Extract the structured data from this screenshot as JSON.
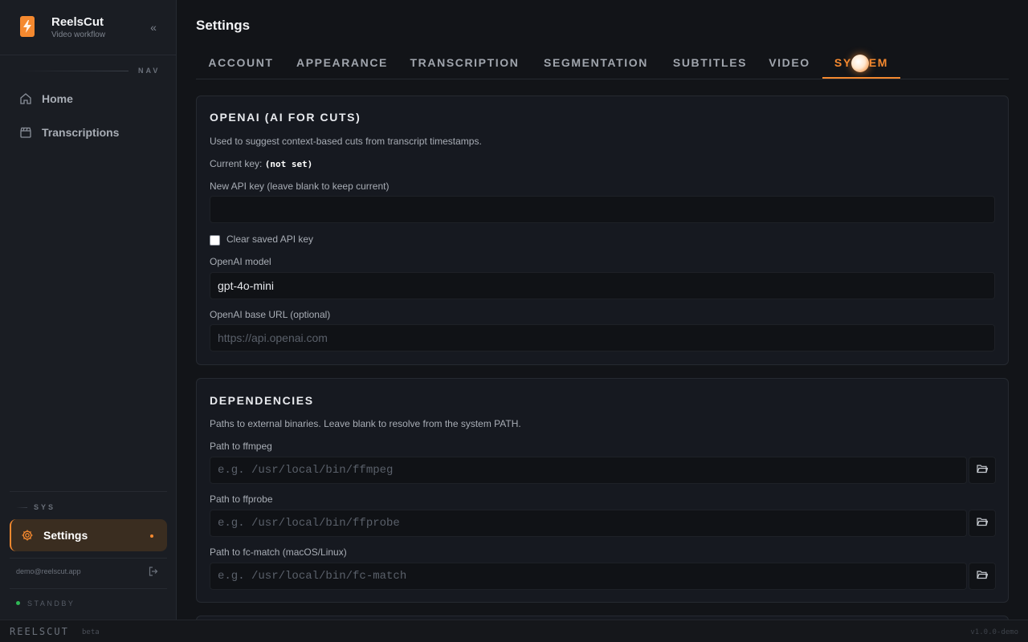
{
  "app": {
    "name": "ReelsCut",
    "subtitle": "Video workflow"
  },
  "sidebar": {
    "nav_section": "NAV",
    "nav_items": [
      {
        "label": "Home",
        "icon": "home-icon"
      },
      {
        "label": "Transcriptions",
        "icon": "clapperboard-icon"
      }
    ],
    "sys_section": "SYS",
    "sys_items": [
      {
        "label": "Settings",
        "icon": "gear-icon",
        "active": true
      }
    ],
    "user_email": "demo@reelscut.app",
    "status": "STANDBY"
  },
  "footer": {
    "brand": "REELSCUT",
    "tag": "beta",
    "version": "v1.0.0-demo"
  },
  "page": {
    "title": "Settings"
  },
  "tabs": [
    {
      "label": "ACCOUNT",
      "active": false
    },
    {
      "label": "APPEARANCE",
      "active": false
    },
    {
      "label": "TRANSCRIPTION",
      "active": false
    },
    {
      "label": "SEGMENTATION",
      "active": false
    },
    {
      "label": "SUBTITLES",
      "active": false
    },
    {
      "label": "VIDEO",
      "active": false
    },
    {
      "label": "SYSTEM",
      "active": true
    }
  ],
  "openai": {
    "title": "OPENAI (AI FOR CUTS)",
    "description": "Used to suggest context-based cuts from transcript timestamps.",
    "current_key_label": "Current key:",
    "current_key_value": "(not set)",
    "api_key_label": "New API key (leave blank to keep current)",
    "api_key_value": "",
    "clear_key_label": "Clear saved API key",
    "clear_key_checked": false,
    "model_label": "OpenAI model",
    "model_value": "gpt-4o-mini",
    "base_url_label": "OpenAI base URL (optional)",
    "base_url_placeholder": "https://api.openai.com"
  },
  "dependencies": {
    "title": "DEPENDENCIES",
    "description": "Paths to external binaries. Leave blank to resolve from the system PATH.",
    "fields": [
      {
        "label": "Path to ffmpeg",
        "placeholder": "e.g. /usr/local/bin/ffmpeg"
      },
      {
        "label": "Path to ffprobe",
        "placeholder": "e.g. /usr/local/bin/ffprobe"
      },
      {
        "label": "Path to fc-match (macOS/Linux)",
        "placeholder": "e.g. /usr/local/bin/fc-match"
      }
    ]
  },
  "colors": {
    "accent": "#f5892f",
    "background": "#121418",
    "sidebar": "#1a1d23",
    "status_ok": "#2fb855"
  }
}
